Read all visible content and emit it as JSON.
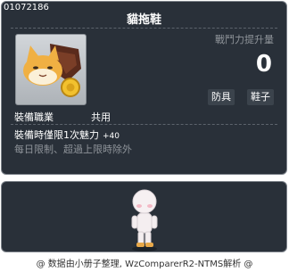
{
  "item": {
    "id": "01072186",
    "name": "貓拖鞋",
    "stat_label": "戰鬥力提升量",
    "stat_value": "0",
    "tags": [
      "防具",
      "鞋子"
    ],
    "job_label": "裝備職業",
    "job_value": "共用",
    "requirement": "裝備時僅限1次魅力",
    "requirement_bonus": "+40",
    "limit_text": "每日限制、超過上限時除外"
  },
  "footer": {
    "text": "@ 数据由小册子整理, WzComparerR2-NTMS解析 @"
  }
}
